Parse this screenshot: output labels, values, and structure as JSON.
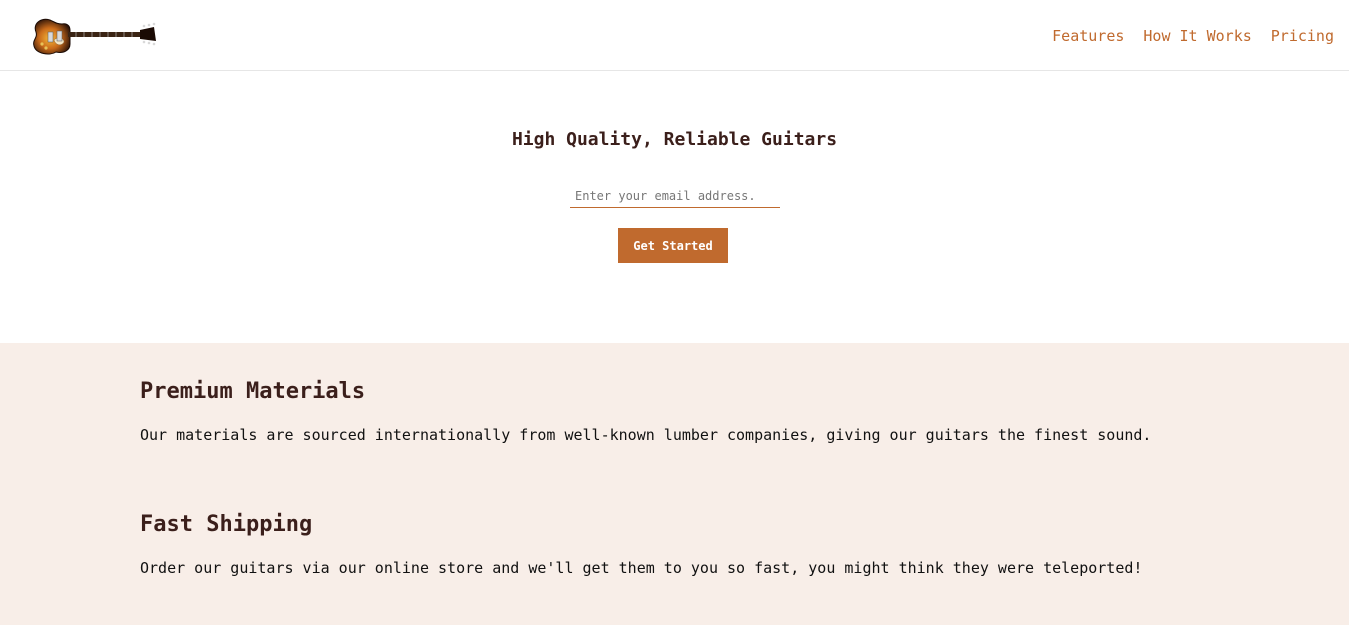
{
  "header": {
    "logo_name": "guitar-logo",
    "nav": [
      {
        "label": "Features"
      },
      {
        "label": "How It Works"
      },
      {
        "label": "Pricing"
      }
    ]
  },
  "hero": {
    "title": "High Quality, Reliable Guitars",
    "email_placeholder": "Enter your email address.",
    "email_value": "",
    "cta_label": "Get Started"
  },
  "features": [
    {
      "title": "Premium Materials",
      "text": "Our materials are sourced internationally from well-known lumber companies, giving our guitars the finest sound."
    },
    {
      "title": "Fast Shipping",
      "text": "Order our guitars via our online store and we'll get them to you so fast, you might think they were teleported!"
    }
  ],
  "colors": {
    "accent": "#c06a2e",
    "heading": "#3b1f1b",
    "features_bg": "#f8eee8"
  }
}
